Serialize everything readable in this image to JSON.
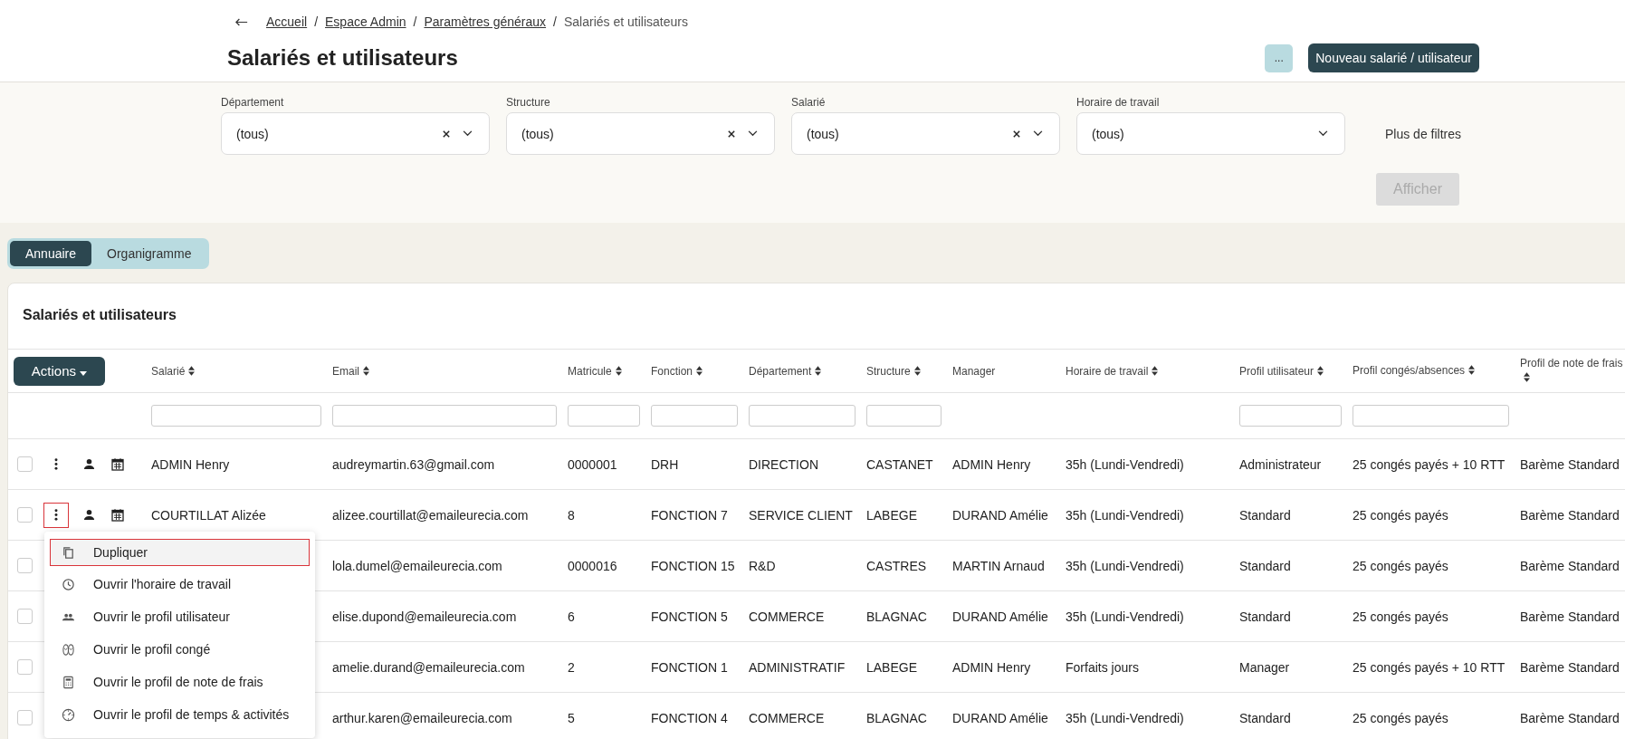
{
  "breadcrumbs": [
    {
      "label": "Accueil",
      "link": true
    },
    {
      "label": "Espace Admin",
      "link": true
    },
    {
      "label": "Paramètres généraux",
      "link": true
    },
    {
      "label": "Salariés et utilisateurs",
      "link": false
    }
  ],
  "breadcrumb_separator": "/",
  "page_title": "Salariés et utilisateurs",
  "header_buttons": {
    "more": "...",
    "primary": "Nouveau salarié / utilisateur"
  },
  "filters": [
    {
      "label": "Département",
      "value": "(tous)",
      "clearable": true
    },
    {
      "label": "Structure",
      "value": "(tous)",
      "clearable": true
    },
    {
      "label": "Salarié",
      "value": "(tous)",
      "clearable": true
    },
    {
      "label": "Horaire de travail",
      "value": "(tous)",
      "clearable": false
    }
  ],
  "more_filters": "Plus de filtres",
  "submit": {
    "label": "Afficher",
    "disabled": true
  },
  "tabs": [
    {
      "label": "Annuaire",
      "selected": true
    },
    {
      "label": "Organigramme",
      "selected": false
    }
  ],
  "table": {
    "title": "Salariés et utilisateurs",
    "actions": "Actions",
    "columns": [
      {
        "label": "Salarié",
        "sortable": true,
        "filter": true
      },
      {
        "label": "Email",
        "sortable": true,
        "filter": true
      },
      {
        "label": "Matricule",
        "sortable": true,
        "filter": true
      },
      {
        "label": "Fonction",
        "sortable": true,
        "filter": true
      },
      {
        "label": "Département",
        "sortable": true,
        "filter": true
      },
      {
        "label": "Structure",
        "sortable": true,
        "filter": true
      },
      {
        "label": "Manager",
        "sortable": false,
        "filter": false
      },
      {
        "label": "Horaire de travail",
        "sortable": true,
        "filter": false
      },
      {
        "label": "Profil utilisateur",
        "sortable": true,
        "filter": true
      },
      {
        "label": "Profil congés/absences",
        "sortable": true,
        "filter": true
      },
      {
        "label": "Profil de note de frais",
        "sortable": true,
        "filter": false
      }
    ],
    "rows": [
      {
        "checked": false,
        "highlighted": false,
        "cells": [
          "ADMIN Henry",
          "audreymartin.63@gmail.com",
          "0000001",
          "DRH",
          "DIRECTION",
          "CASTANET",
          "ADMIN Henry",
          "35h (Lundi-Vendredi)",
          "Administrateur",
          "25 congés payés + 10 RTT",
          "Barème Standard"
        ]
      },
      {
        "checked": false,
        "highlighted": true,
        "cells": [
          "COURTILLAT Alizée",
          "alizee.courtillat@emaileurecia.com",
          "8",
          "FONCTION 7",
          "SERVICE CLIENT",
          "LABEGE",
          "DURAND Amélie",
          "35h (Lundi-Vendredi)",
          "Standard",
          "25 congés payés",
          "Barème Standard"
        ]
      },
      {
        "checked": false,
        "cells": [
          "lola.dumel@emaileurecia.com",
          "0000016",
          "FONCTION 15",
          "R&D",
          "CASTRES",
          "MARTIN Arnaud",
          "35h (Lundi-Vendredi)",
          "Standard",
          "25 congés payés",
          "Barème Standard"
        ]
      },
      {
        "checked": false,
        "cells": [
          "elise.dupond@emaileurecia.com",
          "6",
          "FONCTION 5",
          "COMMERCE",
          "BLAGNAC",
          "DURAND Amélie",
          "35h (Lundi-Vendredi)",
          "Standard",
          "25 congés payés",
          "Barème Standard"
        ]
      },
      {
        "checked": false,
        "cells": [
          "amelie.durand@emaileurecia.com",
          "2",
          "FONCTION 1",
          "ADMINISTRATIF",
          "LABEGE",
          "ADMIN Henry",
          "Forfaits jours",
          "Manager",
          "25 congés payés + 10 RTT",
          "Barème Standard"
        ]
      },
      {
        "checked": false,
        "cells": [
          "arthur.karen@emaileurecia.com",
          "5",
          "FONCTION 4",
          "COMMERCE",
          "BLAGNAC",
          "DURAND Amélie",
          "35h (Lundi-Vendredi)",
          "Standard",
          "25 congés payés",
          "Barème Standard"
        ]
      }
    ]
  },
  "row_menu": [
    {
      "label": "Dupliquer",
      "highlighted": true
    },
    {
      "label": "Ouvrir l'horaire de travail",
      "highlighted": false
    },
    {
      "label": "Ouvrir le profil utilisateur",
      "highlighted": false
    },
    {
      "label": "Ouvrir le profil congé",
      "highlighted": false
    },
    {
      "label": "Ouvrir le profil de note de frais",
      "highlighted": false
    },
    {
      "label": "Ouvrir le profil de temps & activités",
      "highlighted": false
    }
  ]
}
